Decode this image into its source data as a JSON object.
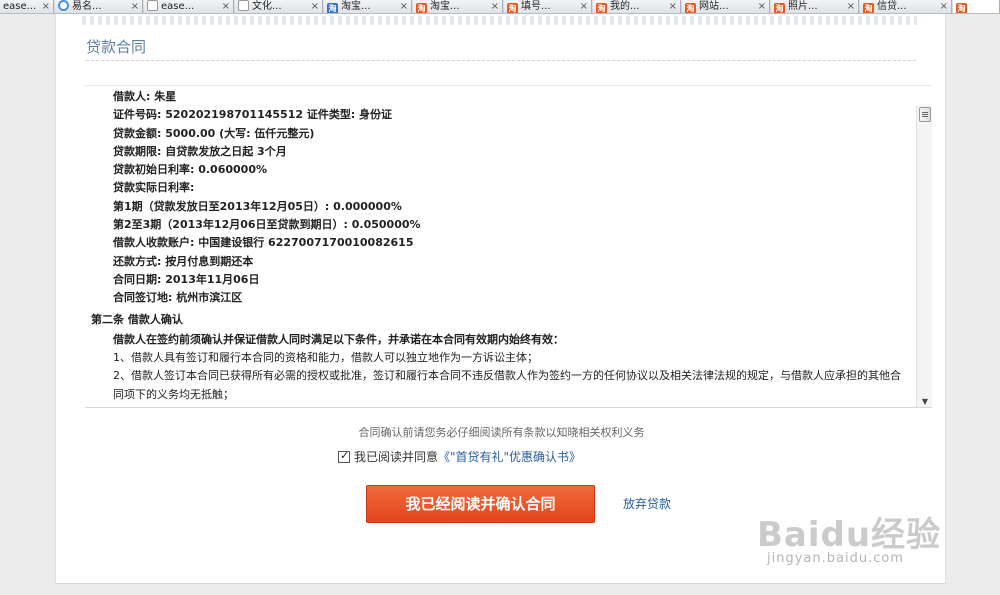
{
  "tabs": [
    {
      "label": "ease...",
      "icon": "none"
    },
    {
      "label": "易名...",
      "icon": "round"
    },
    {
      "label": "ease...",
      "icon": "doc"
    },
    {
      "label": "文化...",
      "icon": "doc"
    },
    {
      "label": "淘宝...",
      "icon": "blue"
    },
    {
      "label": "淘宝...",
      "icon": "orange"
    },
    {
      "label": "填号...",
      "icon": "orange"
    },
    {
      "label": "我的...",
      "icon": "orange"
    },
    {
      "label": "网站...",
      "icon": "orange"
    },
    {
      "label": "照片...",
      "icon": "orange"
    },
    {
      "label": "信贷...",
      "icon": "orange"
    },
    {
      "label": "",
      "icon": "orange"
    }
  ],
  "page": {
    "title": "贷款合同"
  },
  "contract": {
    "lines": [
      "借款人: 朱星",
      "证件号码: 520202198701145512 证件类型: 身份证",
      "贷款金额: 5000.00 (大写: 伍仟元整元)",
      "贷款期限: 自贷款发放之日起 3个月",
      "贷款初始日利率: 0.060000%",
      "贷款实际日利率:",
      "第1期（贷款发放日至2013年12月05日）: 0.000000%",
      "第2至3期（2013年12月06日至贷款到期日）: 0.050000%",
      "借款人收款账户: 中国建设银行 6227007170010082615",
      "还款方式: 按月付息到期还本",
      "合同日期: 2013年11月06日",
      "合同签订地: 杭州市滨江区"
    ],
    "section2_title": "第二条 借款人确认",
    "section2_intro": "借款人在签约前须确认并保证借款人同时满足以下条件，并承诺在本合同有效期内始终有效：",
    "section2_item1": "1、借款人具有签订和履行本合同的资格和能力，借款人可以独立地作为一方诉讼主体；",
    "section2_item2": "2、借款人签订本合同已获得所有必需的授权或批准，签订和履行本合同不违反借款人作为签约一方的任何协议以及相关法律法规的规定，与借款人应承担的其他合同项下的义务均无抵触；"
  },
  "footer": {
    "notice": "合同确认前请您务必仔细阅读所有条款以知晓相关权利义务",
    "agree_label": "我已阅读并同意",
    "agree_link": "《\"首贷有礼\"优惠确认书》",
    "agree_checked": true,
    "confirm_button": "我已经阅读并确认合同",
    "abandon_link": "放弃贷款"
  },
  "watermark": {
    "logo": "Baidu经验",
    "url": "jingyan.baidu.com"
  }
}
